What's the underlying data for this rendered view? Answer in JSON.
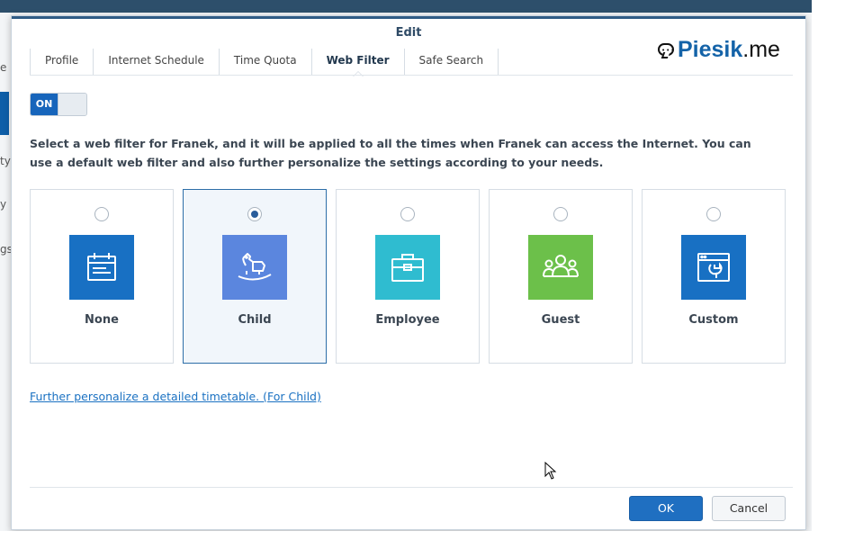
{
  "background": {
    "side_texts": [
      "e",
      "ty",
      "y",
      "gs"
    ]
  },
  "dialog": {
    "title": "Edit",
    "brand": {
      "name_part1": "Piesik",
      "name_part2": ".me"
    },
    "tabs": [
      {
        "label": "Profile",
        "active": false
      },
      {
        "label": "Internet Schedule",
        "active": false
      },
      {
        "label": "Time Quota",
        "active": false
      },
      {
        "label": "Web Filter",
        "active": true
      },
      {
        "label": "Safe Search",
        "active": false
      }
    ],
    "toggle": {
      "label": "ON",
      "state": true
    },
    "description": "Select a web filter for Franek, and it will be applied to all the times when Franek can access the Internet. You can use a default web filter and also further personalize the settings according to your needs.",
    "filters": [
      {
        "label": "None",
        "icon": "calendar-icon",
        "color": "#1870c3",
        "selected": false
      },
      {
        "label": "Child",
        "icon": "rocking-horse-icon",
        "color": "#5b86de",
        "selected": true
      },
      {
        "label": "Employee",
        "icon": "briefcase-icon",
        "color": "#2fbcd0",
        "selected": false
      },
      {
        "label": "Guest",
        "icon": "group-icon",
        "color": "#6cc04a",
        "selected": false
      },
      {
        "label": "Custom",
        "icon": "browser-wrench-icon",
        "color": "#1870c3",
        "selected": false
      }
    ],
    "personalize_link": "Further personalize a detailed timetable. (For Child)",
    "buttons": {
      "ok": "OK",
      "cancel": "Cancel"
    }
  }
}
